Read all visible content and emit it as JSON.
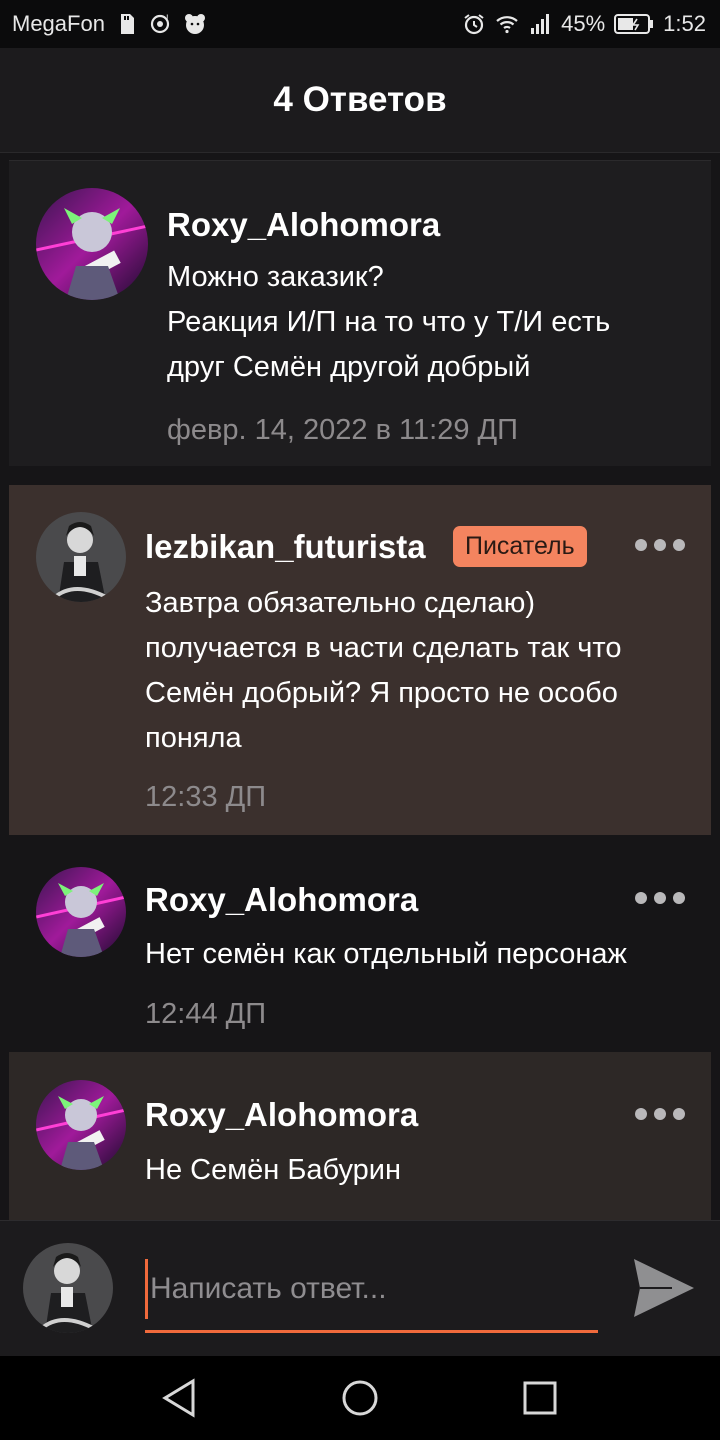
{
  "status_bar": {
    "carrier": "MegaFon",
    "battery_percent": "45%",
    "time": "1:52",
    "icons": [
      "sdcard-icon",
      "hotspot-icon",
      "bear-app-icon",
      "alarm-icon",
      "wifi-icon",
      "signal-icon",
      "battery-icon"
    ]
  },
  "header": {
    "title": "4 Ответов"
  },
  "original_post": {
    "author": "Roxy_Alohomora",
    "lines": [
      "Можно заказик?",
      "Реакция И/П на то что у Т/И есть",
      "друг Семён другой добрый"
    ],
    "timestamp": "февр. 14, 2022 в 11:29 ДП"
  },
  "replies": [
    {
      "author": "lezbikan_futurista",
      "badge": "Писатель",
      "lines": [
        "Завтра обязательно сделаю)",
        "получается в части сделать так что",
        "Семён добрый? Я просто не особо",
        "поняла"
      ],
      "timestamp": "12:33 ДП"
    },
    {
      "author": "Roxy_Alohomora",
      "lines": [
        "Нет семён как отдельный персонаж"
      ],
      "timestamp": "12:44 ДП"
    },
    {
      "author": "Roxy_Alohomora",
      "lines": [
        "Не Семён Бабурин"
      ]
    }
  ],
  "composer": {
    "placeholder": "Написать ответ...",
    "value": ""
  },
  "colors": {
    "accent": "#f06a3c",
    "badge": "#f4845f",
    "highlight_bg": "#3b302d",
    "card_bg": "#1e1d1f",
    "page_bg": "#161517"
  }
}
